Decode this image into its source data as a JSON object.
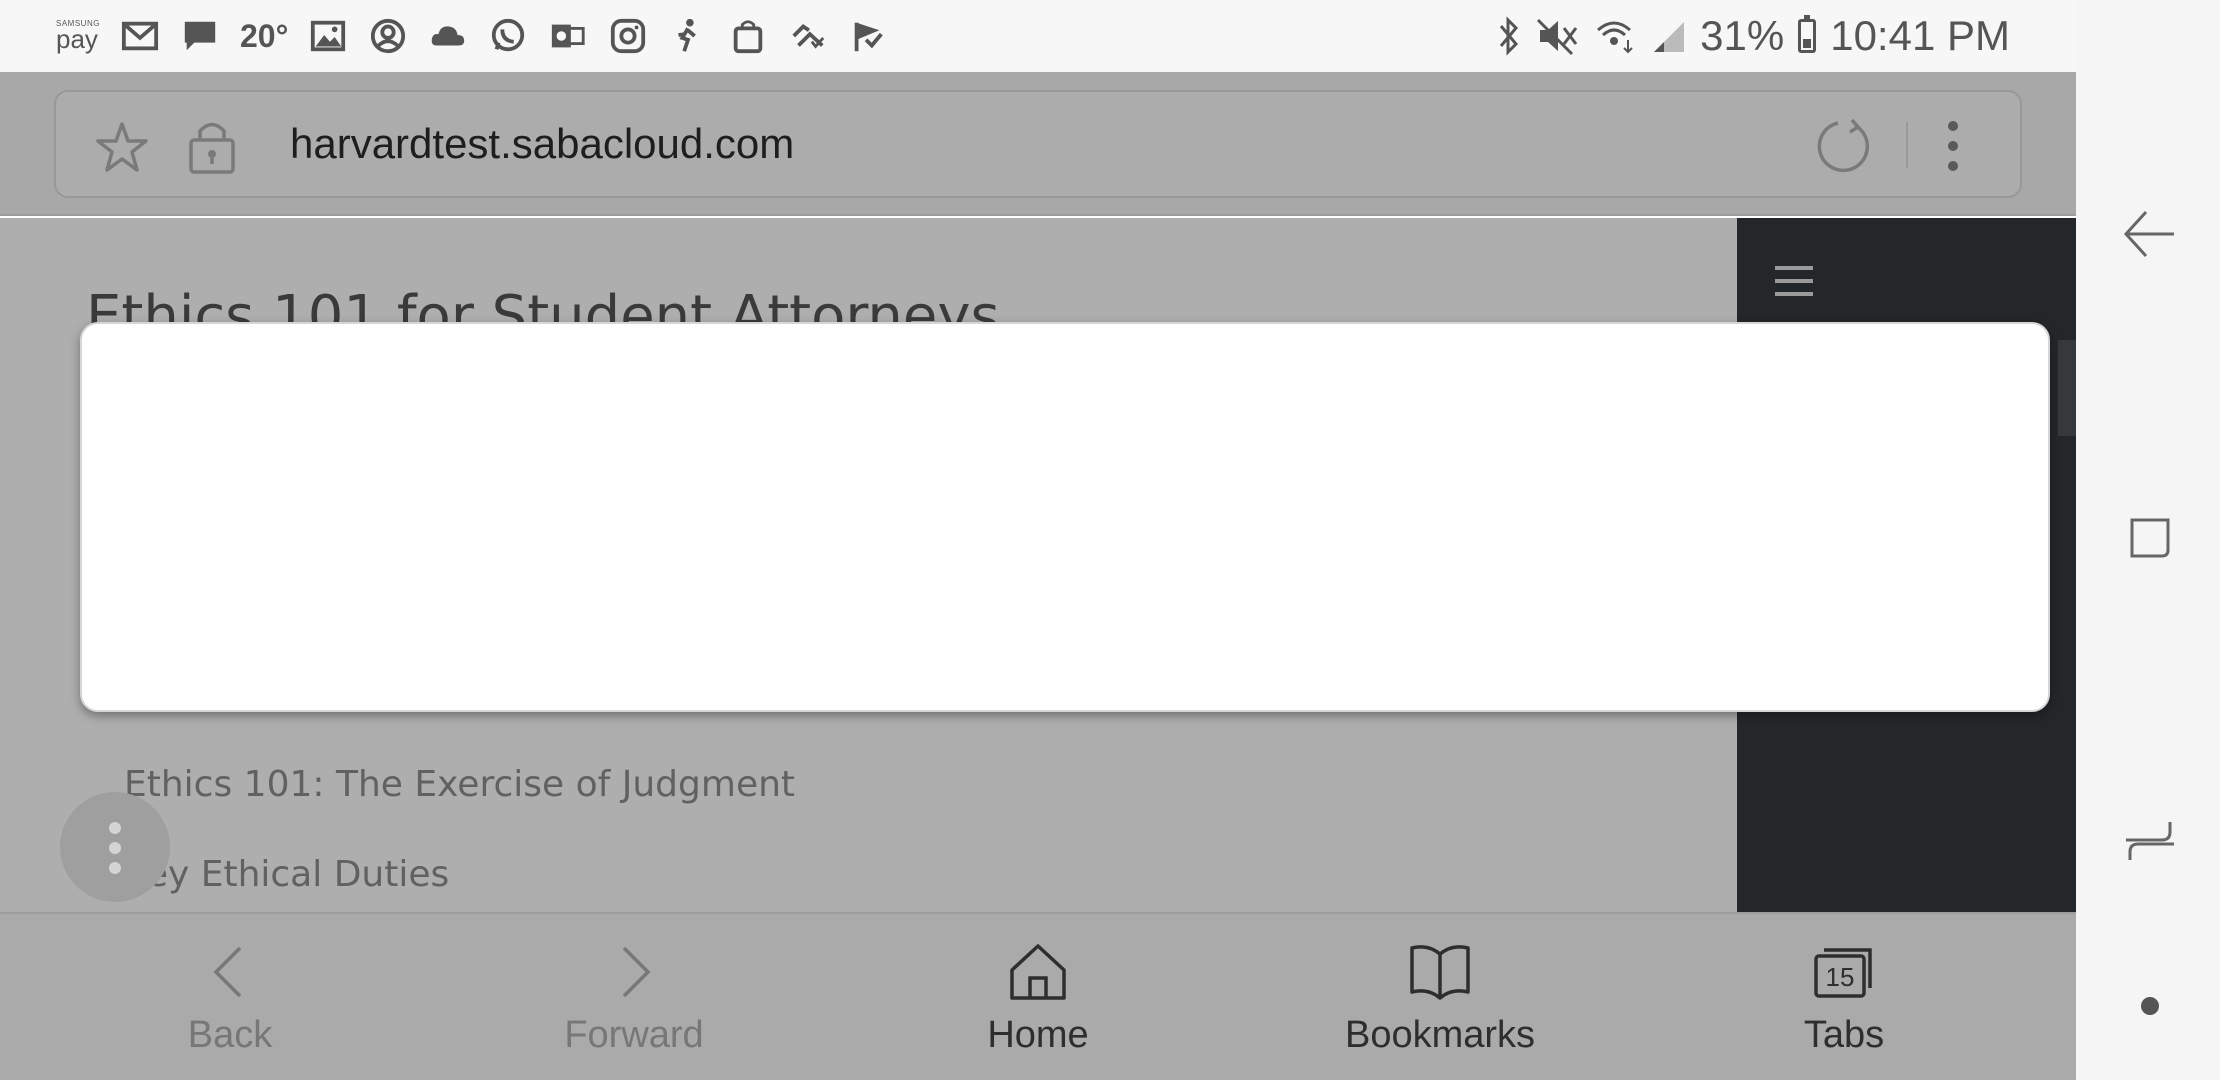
{
  "status_bar": {
    "samsung_pay_small": "SAMSUNG",
    "samsung_pay_big": "pay",
    "temperature": "20°",
    "battery_percent": "31%",
    "time": "10:41 PM",
    "battery_level": 0.31,
    "left_icons": [
      "gmail-icon",
      "messages-icon",
      "gallery-icon",
      "account-icon",
      "cloud-icon",
      "whatsapp-icon",
      "outlook-icon",
      "instagram-icon",
      "pedometer-icon",
      "shopping-bag-icon",
      "sync-icon",
      "check-flag-icon"
    ],
    "right_icons": [
      "bluetooth-icon",
      "mute-icon",
      "wifi-icon",
      "signal-icon"
    ]
  },
  "browser": {
    "url": "harvardtest.sabacloud.com"
  },
  "page": {
    "title": "Ethics 101 for Student Attorneys",
    "links": [
      "Ethics 101: The Exercise of Judgment",
      "Key Ethical Duties"
    ]
  },
  "bottom_nav": {
    "back": "Back",
    "forward": "Forward",
    "home": "Home",
    "bookmarks": "Bookmarks",
    "tabs": "Tabs",
    "tab_count": "15"
  },
  "colors": {
    "overlay_gray": "#aeaeae",
    "side_panel": "#24272a",
    "modal_bg": "#ffffff"
  }
}
